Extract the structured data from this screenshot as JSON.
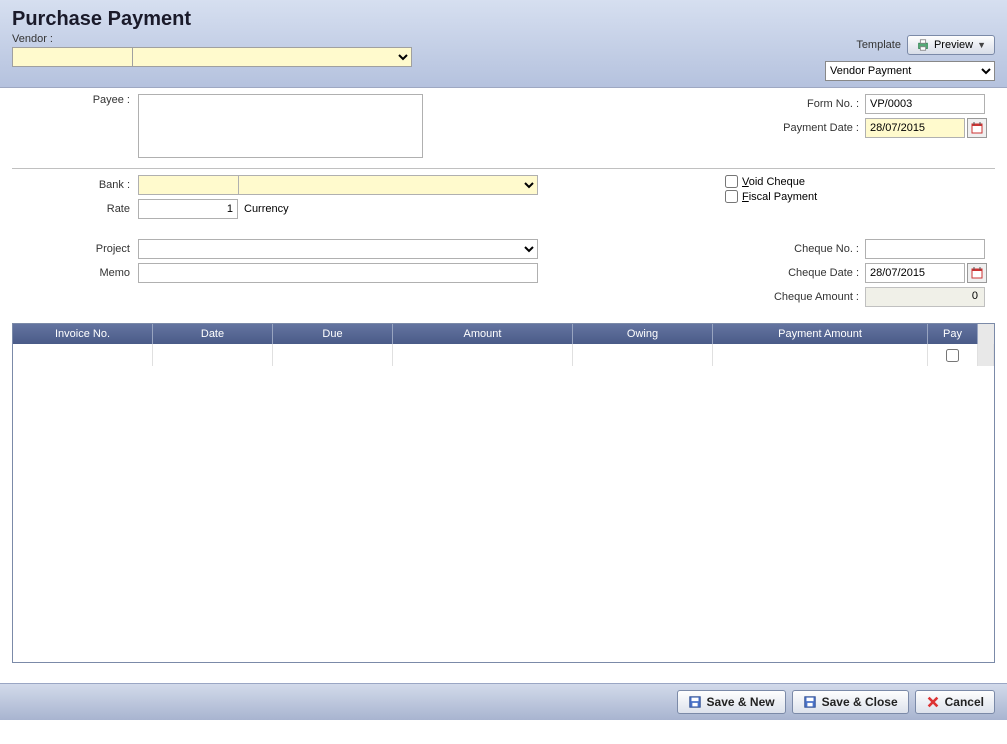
{
  "header": {
    "title": "Purchase Payment",
    "vendor_label": "Vendor :",
    "vendor_code": "",
    "vendor_name": "",
    "template_label": "Template",
    "preview_label": "Preview",
    "template_selected": "Vendor Payment"
  },
  "form": {
    "payee_label": "Payee :",
    "payee_value": "",
    "formno_label": "Form No. :",
    "formno_value": "VP/0003",
    "paymentdate_label": "Payment Date :",
    "paymentdate_value": "28/07/2015",
    "bank_label": "Bank :",
    "bank_code": "",
    "bank_name": "",
    "rate_label": "Rate",
    "rate_value": "1",
    "currency_label": "Currency",
    "void_label": "Void Cheque",
    "fiscal_label": "Fiscal Payment",
    "project_label": "Project",
    "project_value": "",
    "memo_label": "Memo",
    "memo_value": "",
    "chequeno_label": "Cheque No. :",
    "chequeno_value": "",
    "chequedate_label": "Cheque Date :",
    "chequedate_value": "28/07/2015",
    "chequeamt_label": "Cheque Amount :",
    "chequeamt_value": "0"
  },
  "grid": {
    "columns": {
      "invoice": "Invoice No.",
      "date": "Date",
      "due": "Due",
      "amount": "Amount",
      "owing": "Owing",
      "payamt": "Payment Amount",
      "pay": "Pay"
    }
  },
  "footer": {
    "save_new": "Save & New",
    "save_close": "Save & Close",
    "cancel": "Cancel"
  }
}
